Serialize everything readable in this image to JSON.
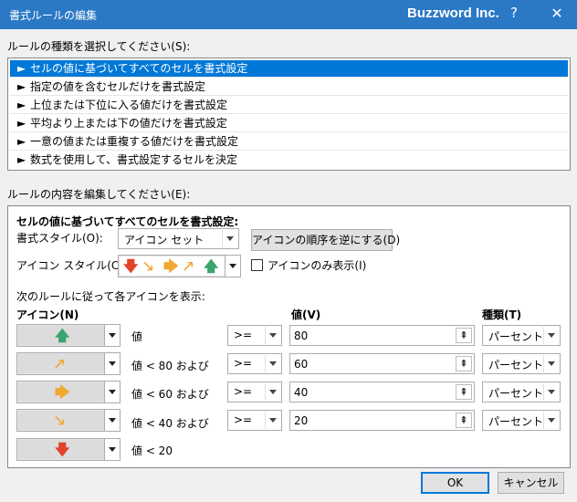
{
  "window": {
    "title": "書式ルールの編集",
    "brand": "Buzzword Inc.",
    "help": "?",
    "close": "✕"
  },
  "rule_type": {
    "label": "ルールの種類を選択してください(S):",
    "items": [
      "セルの値に基づいてすべてのセルを書式設定",
      "指定の値を含むセルだけを書式設定",
      "上位または下位に入る値だけを書式設定",
      "平均より上または下の値だけを書式設定",
      "一意の値または重複する値だけを書式設定",
      "数式を使用して、書式設定するセルを決定"
    ],
    "arrow": "►"
  },
  "edit": {
    "label": "ルールの内容を編集してください(E):",
    "heading": "セルの値に基づいてすべてのセルを書式設定:",
    "format_style_label": "書式スタイル(O):",
    "format_style_value": "アイコン セット",
    "reverse_button": "アイコンの順序を逆にする(D)",
    "icon_style_label": "アイコン スタイル(C):",
    "icon_only_label": "アイコンのみ表示(I)",
    "rules_caption": "次のルールに従って各アイコンを表示:",
    "col_icon": "アイコン(N)",
    "col_value": "値(V)",
    "col_type": "種類(T)",
    "rows": [
      {
        "icon": "arrow-up-green",
        "desc": "値",
        "op": ">=",
        "value": "80",
        "type": "パーセント"
      },
      {
        "icon": "arrow-up-right-yellow",
        "desc": "値 < 80 および",
        "op": ">=",
        "value": "60",
        "type": "パーセント"
      },
      {
        "icon": "arrow-right-yellow",
        "desc": "値 < 60 および",
        "op": ">=",
        "value": "40",
        "type": "パーセント"
      },
      {
        "icon": "arrow-down-right-yellow",
        "desc": "値 < 40 および",
        "op": ">=",
        "value": "20",
        "type": "パーセント"
      },
      {
        "icon": "arrow-down-red",
        "desc": "値 < 20"
      }
    ]
  },
  "buttons": {
    "ok": "OK",
    "cancel": "キャンセル"
  },
  "colors": {
    "green": "#3aa56e",
    "yellow": "#f0a830",
    "red": "#e0442a",
    "selection": "#0078d7",
    "titlebar": "#2b78c5"
  }
}
